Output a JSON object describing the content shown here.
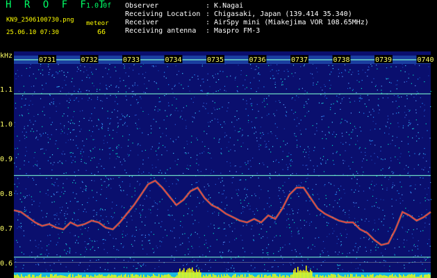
{
  "header": {
    "title": "H R O F F T",
    "version": "1.0.0f",
    "filename": "KN9_2506100730.png",
    "timestamp": "25.06.10 07:30",
    "meteor_label": "meteor",
    "meteor_count": "66",
    "info": [
      {
        "key": "Observer",
        "value": ": K.Nagai"
      },
      {
        "key": "Receiving Location",
        "value": ": Chigasaki, Japan (139.414 35.340)"
      },
      {
        "key": "Receiver",
        "value": ": AirSpy mini (Miakejima VOR 108.65MHz)"
      },
      {
        "key": "Receiving antenna",
        "value": ": Maspro FM-3"
      }
    ]
  },
  "chart_data": {
    "type": "heatmap",
    "ylabel": "kHz",
    "y_ticks": [
      "1.1",
      "1.0",
      "0.9",
      "0.8",
      "0.7",
      "0.6"
    ],
    "time_ticks": [
      "0731",
      "0732",
      "0733",
      "0734",
      "0735",
      "0736",
      "0737",
      "0738",
      "0739",
      "0740"
    ],
    "horizontal_lines_khz": [
      1.09,
      0.855,
      0.62
    ],
    "trace_khz": [
      0.755,
      0.75,
      0.735,
      0.72,
      0.71,
      0.715,
      0.705,
      0.7,
      0.72,
      0.71,
      0.715,
      0.725,
      0.72,
      0.705,
      0.7,
      0.72,
      0.745,
      0.77,
      0.8,
      0.83,
      0.84,
      0.82,
      0.795,
      0.77,
      0.785,
      0.81,
      0.82,
      0.79,
      0.77,
      0.76,
      0.745,
      0.735,
      0.725,
      0.72,
      0.73,
      0.72,
      0.74,
      0.73,
      0.76,
      0.8,
      0.82,
      0.82,
      0.79,
      0.76,
      0.745,
      0.735,
      0.725,
      0.72,
      0.72,
      0.7,
      0.69,
      0.67,
      0.655,
      0.66,
      0.7,
      0.75,
      0.74,
      0.725,
      0.735,
      0.75
    ],
    "colors": {
      "background": "#0a0f6e",
      "trace": "#ff3b3b",
      "lines": "#7fffd4",
      "labels": "#ffff66"
    }
  }
}
